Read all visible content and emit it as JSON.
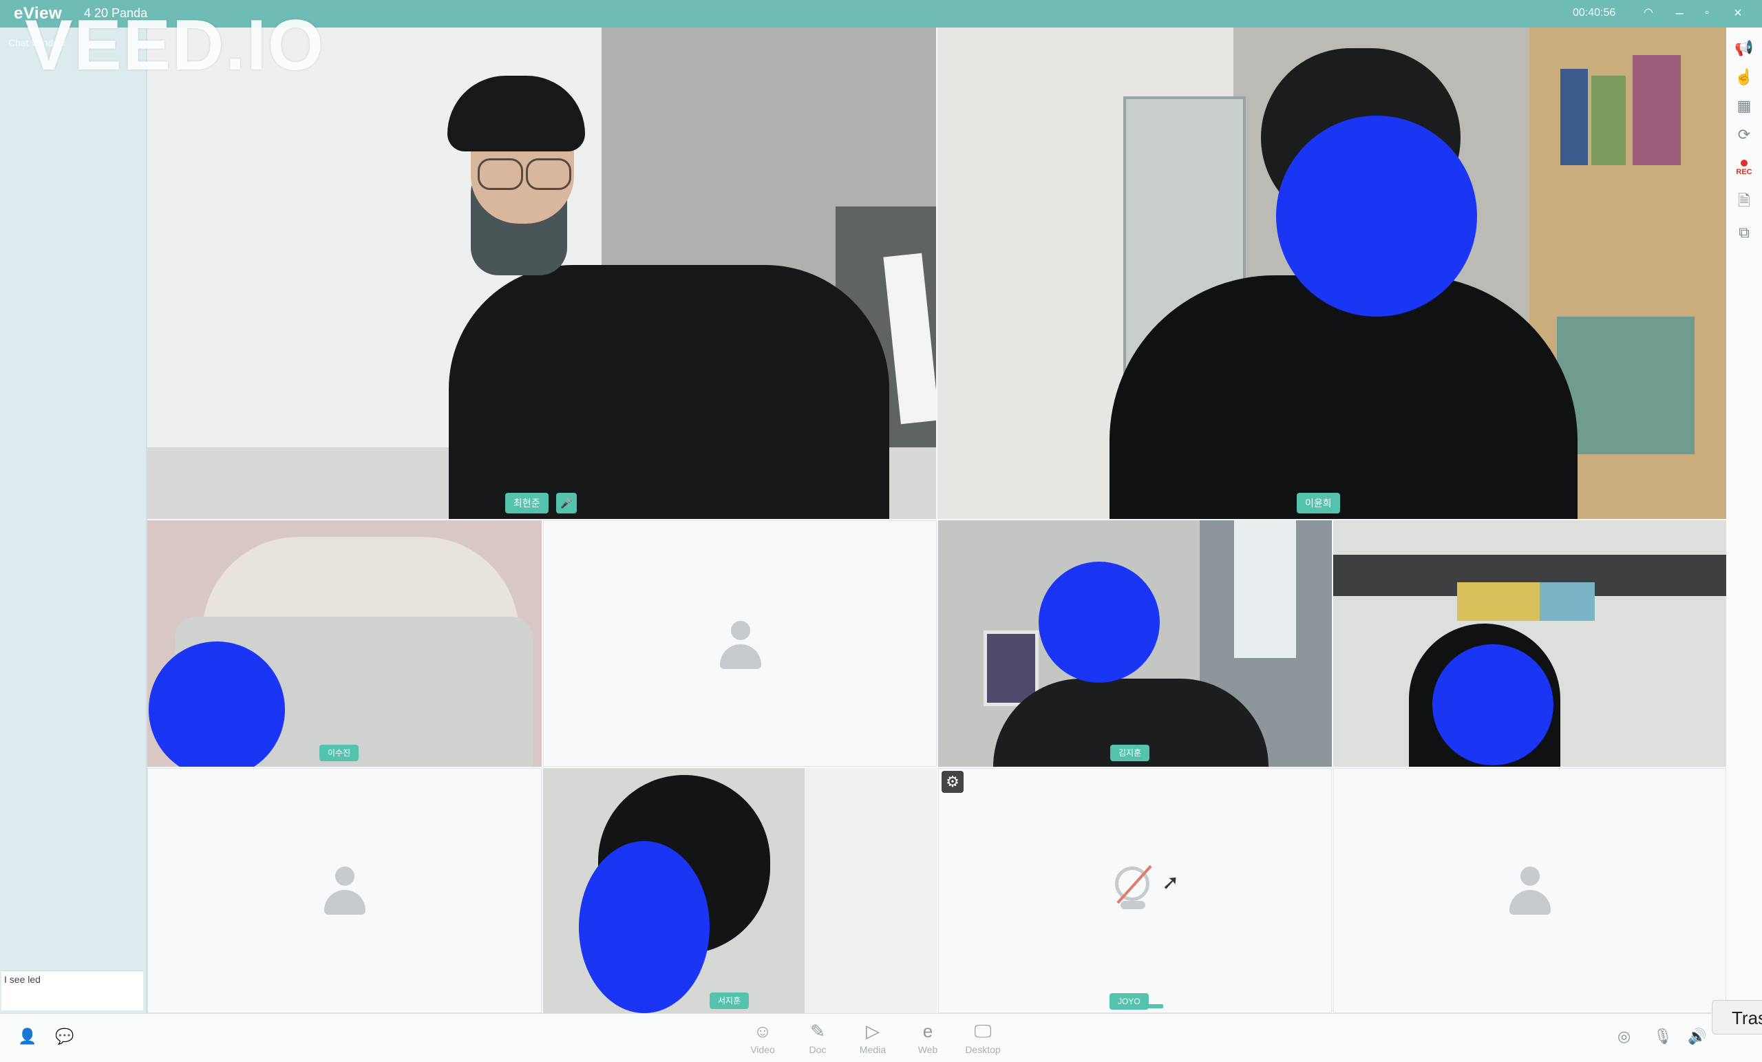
{
  "window": {
    "app_name": "eView",
    "room_title": "4 20 Panda",
    "timer": "00:40:56",
    "controls": {
      "minimize": "–",
      "restore": "▫",
      "close": "×"
    }
  },
  "watermark": "VEED.IO",
  "chat_panel": {
    "tab_label": "Chat Window",
    "input_text": "I see led"
  },
  "tiles": [
    {
      "id": "tile-1",
      "has_video": true,
      "name_tag": "최현준",
      "background": "#c7c9c8"
    },
    {
      "id": "tile-2",
      "has_video": true,
      "name_tag": "이윤희",
      "background": "#b9b7b1"
    },
    {
      "id": "tile-3",
      "has_video": true,
      "name_tag": "이수진",
      "background": "#d9c8c6"
    },
    {
      "id": "tile-4",
      "has_video": false,
      "name_tag": ""
    },
    {
      "id": "tile-5",
      "has_video": true,
      "name_tag": "김지훈",
      "background": "#8b9498"
    },
    {
      "id": "tile-6",
      "has_video": true,
      "name_tag": "",
      "background": "#c9ccc8"
    },
    {
      "id": "tile-7",
      "has_video": false,
      "name_tag": ""
    },
    {
      "id": "tile-8",
      "has_video": true,
      "name_tag": "서지훈",
      "background": "#d2d4d1"
    },
    {
      "id": "tile-9",
      "has_video": false,
      "name_tag": "JOYO",
      "camera_off": true
    },
    {
      "id": "tile-10",
      "has_video": false,
      "name_tag": ""
    }
  ],
  "right_tools": [
    {
      "name": "announce-icon",
      "glyph": "📢"
    },
    {
      "name": "pointer-icon",
      "glyph": "☝"
    },
    {
      "name": "layout-icon",
      "glyph": "▦"
    },
    {
      "name": "refresh-icon",
      "glyph": "⟳"
    },
    {
      "name": "record-icon",
      "label": "REC"
    },
    {
      "name": "document-icon",
      "glyph": "🗎"
    },
    {
      "name": "share-icon",
      "glyph": "⧉"
    }
  ],
  "bottom_toolbar": {
    "items": [
      {
        "key": "video",
        "label": "Video",
        "icon": "☺"
      },
      {
        "key": "doc",
        "label": "Doc",
        "icon": "✎"
      },
      {
        "key": "media",
        "label": "Media",
        "icon": "▷"
      },
      {
        "key": "web",
        "label": "Web",
        "icon": "e"
      },
      {
        "key": "desktop",
        "label": "Desktop",
        "icon": "🖵"
      }
    ],
    "tooltip": "Tras"
  }
}
